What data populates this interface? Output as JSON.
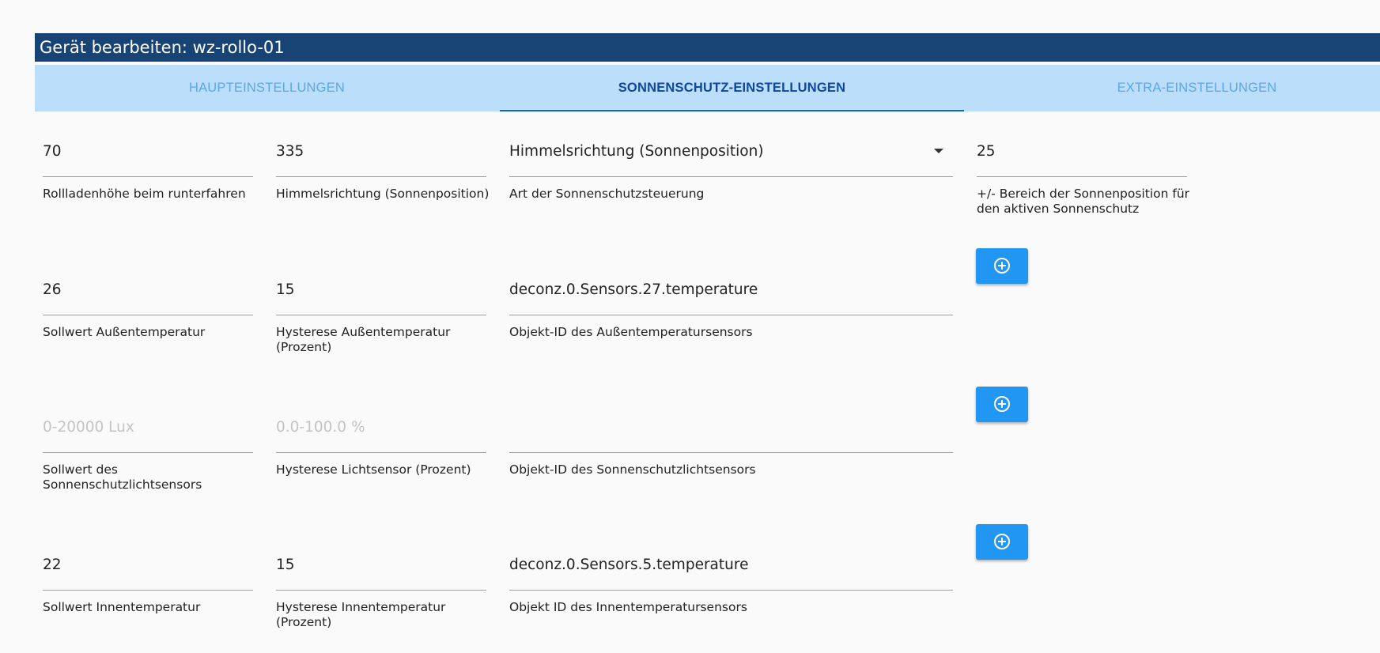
{
  "window": {
    "title": "Gerät bearbeiten: wz-rollo-01"
  },
  "tabs": [
    {
      "label": "HAUPTEINSTELLUNGEN",
      "active": false
    },
    {
      "label": "SONNENSCHUTZ-EINSTELLUNGEN",
      "active": true
    },
    {
      "label": "EXTRA-EINSTELLUNGEN",
      "active": false
    }
  ],
  "fields": {
    "shutter_height": {
      "value": "70",
      "label": "Rollladenhöhe beim runterfahren"
    },
    "direction": {
      "value": "335",
      "label": "Himmelsrichtung (Sonnenposition)"
    },
    "control_type": {
      "value": "Himmelsrichtung (Sonnenposition)",
      "label": "Art der Sonnenschutzsteuerung"
    },
    "sun_range": {
      "value": "25",
      "label_line1": "+/- Bereich der Sonnenposition für",
      "label_line2": "den aktiven Sonnenschutz"
    },
    "outside_temp_setpoint": {
      "value": "26",
      "label": "Sollwert Außentemperatur"
    },
    "outside_temp_hysteresis": {
      "value": "15",
      "label_line1": "Hysterese Außentemperatur",
      "label_line2": "(Prozent)"
    },
    "outside_temp_sensor": {
      "value": "deconz.0.Sensors.27.temperature",
      "label": "Objekt-ID des Außentemperatursensors"
    },
    "light_setpoint": {
      "value": "",
      "placeholder": "0-20000 Lux",
      "label_line1": "Sollwert des",
      "label_line2": "Sonnenschutzlichtsensors"
    },
    "light_hysteresis": {
      "value": "",
      "placeholder": "0.0-100.0 %",
      "label": "Hysterese Lichtsensor (Prozent)"
    },
    "light_sensor": {
      "value": "",
      "label": "Objekt-ID des Sonnenschutzlichtsensors"
    },
    "inside_temp_setpoint": {
      "value": "22",
      "label": "Sollwert Innentemperatur"
    },
    "inside_temp_hysteresis": {
      "value": "15",
      "label_line1": "Hysterese Innentemperatur",
      "label_line2": "(Prozent)"
    },
    "inside_temp_sensor": {
      "value": "deconz.0.Sensors.5.temperature",
      "label": "Objekt ID des Innentemperatursensors"
    }
  },
  "icons": {
    "add": "add-circle-icon",
    "dropdown": "chevron-down-icon"
  },
  "colors": {
    "title_bar": "#174475",
    "tab_bar": "#bbdefb",
    "tab_active_text": "#0d47a1",
    "tab_inactive_text": "#58a7ee",
    "button": "#2196f3"
  }
}
